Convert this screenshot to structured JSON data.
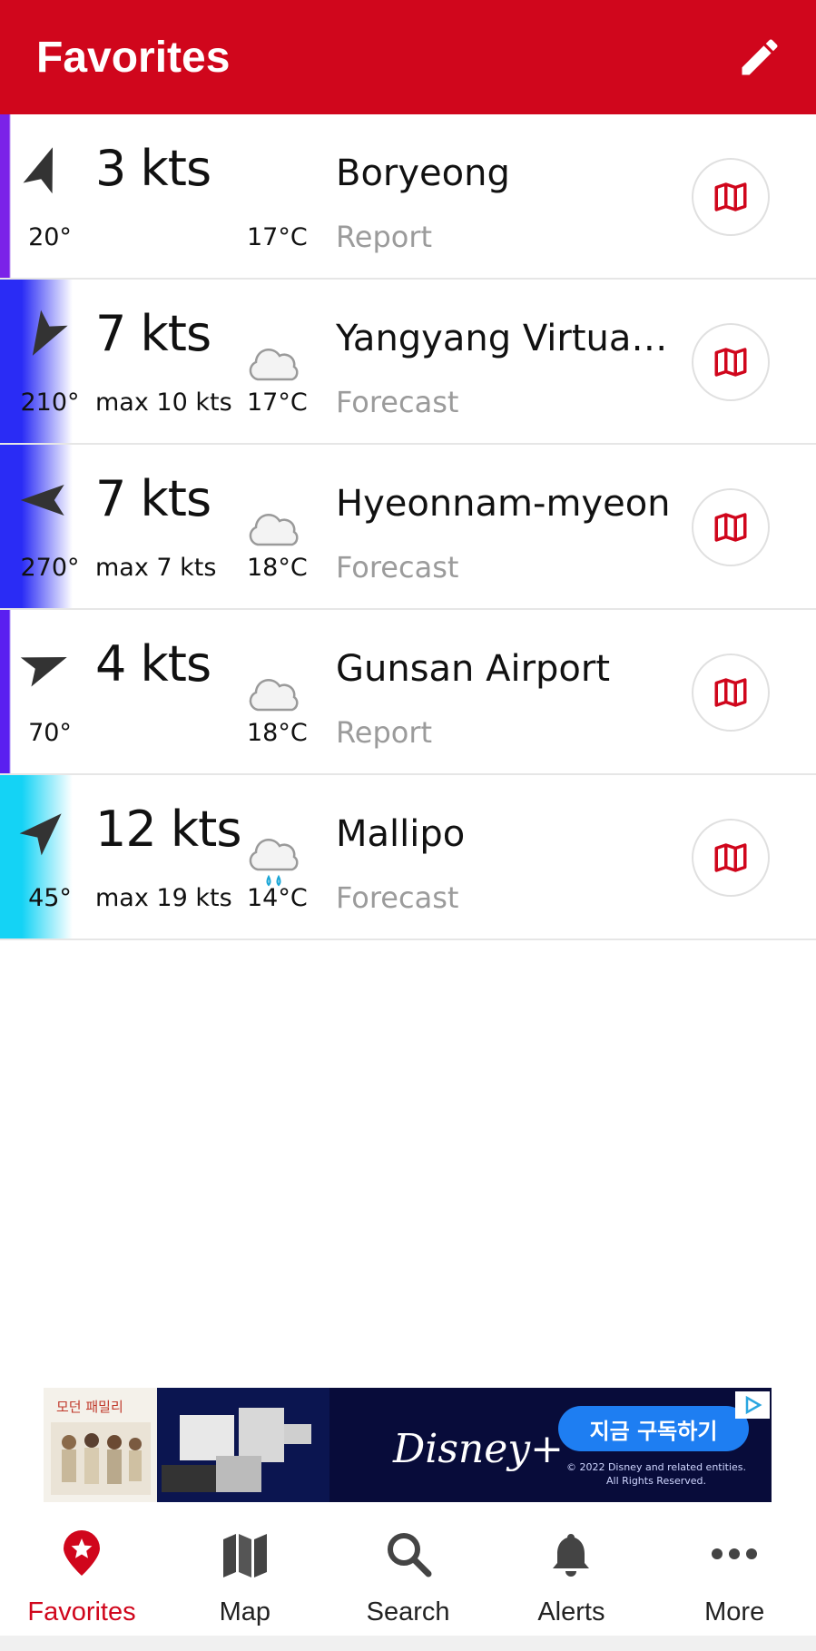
{
  "header": {
    "title": "Favorites",
    "edit_icon": "pencil-icon"
  },
  "colors": {
    "brand": "#d0061c",
    "secondary_text": "#9b9b9b"
  },
  "favorites": [
    {
      "direction_deg": "20°",
      "speed": "3 kts",
      "max": "",
      "weather": "",
      "temp": "17°C",
      "name": "Boryeong",
      "type": "Report",
      "stripe": "#7b22e8",
      "stripe_fade": false,
      "arrow_rotation": 20
    },
    {
      "direction_deg": "210°",
      "speed": "7 kts",
      "max": "max 10 kts",
      "weather": "cloudy",
      "temp": "17°C",
      "name": "Yangyang Virtual B…",
      "type": "Forecast",
      "stripe": "#2a2cf5",
      "stripe_fade": true,
      "arrow_rotation": 210
    },
    {
      "direction_deg": "270°",
      "speed": "7 kts",
      "max": "max 7 kts",
      "weather": "cloudy",
      "temp": "18°C",
      "name": "Hyeonnam-myeon",
      "type": "Forecast",
      "stripe": "#2a2cf5",
      "stripe_fade": true,
      "arrow_rotation": 270
    },
    {
      "direction_deg": "70°",
      "speed": "4 kts",
      "max": "",
      "weather": "cloudy",
      "temp": "18°C",
      "name": "Gunsan Airport",
      "type": "Report",
      "stripe": "#5a1ff0",
      "stripe_fade": false,
      "arrow_rotation": 70
    },
    {
      "direction_deg": "45°",
      "speed": "12 kts",
      "max": "max 19 kts",
      "weather": "rain",
      "temp": "14°C",
      "name": "Mallipo",
      "type": "Forecast",
      "stripe": "#14d3f5",
      "stripe_fade": true,
      "arrow_rotation": 45
    }
  ],
  "ad": {
    "left_title": "모던 패밀리",
    "brand": "Disney+",
    "cta": "지금 구독하기",
    "copyright_1": "© 2022 Disney and related entities.",
    "copyright_2": "All Rights Reserved."
  },
  "tabs": [
    {
      "label": "Favorites",
      "icon": "star-pin-icon",
      "active": true
    },
    {
      "label": "Map",
      "icon": "map-icon",
      "active": false
    },
    {
      "label": "Search",
      "icon": "search-icon",
      "active": false
    },
    {
      "label": "Alerts",
      "icon": "bell-icon",
      "active": false
    },
    {
      "label": "More",
      "icon": "more-dots-icon",
      "active": false
    }
  ]
}
